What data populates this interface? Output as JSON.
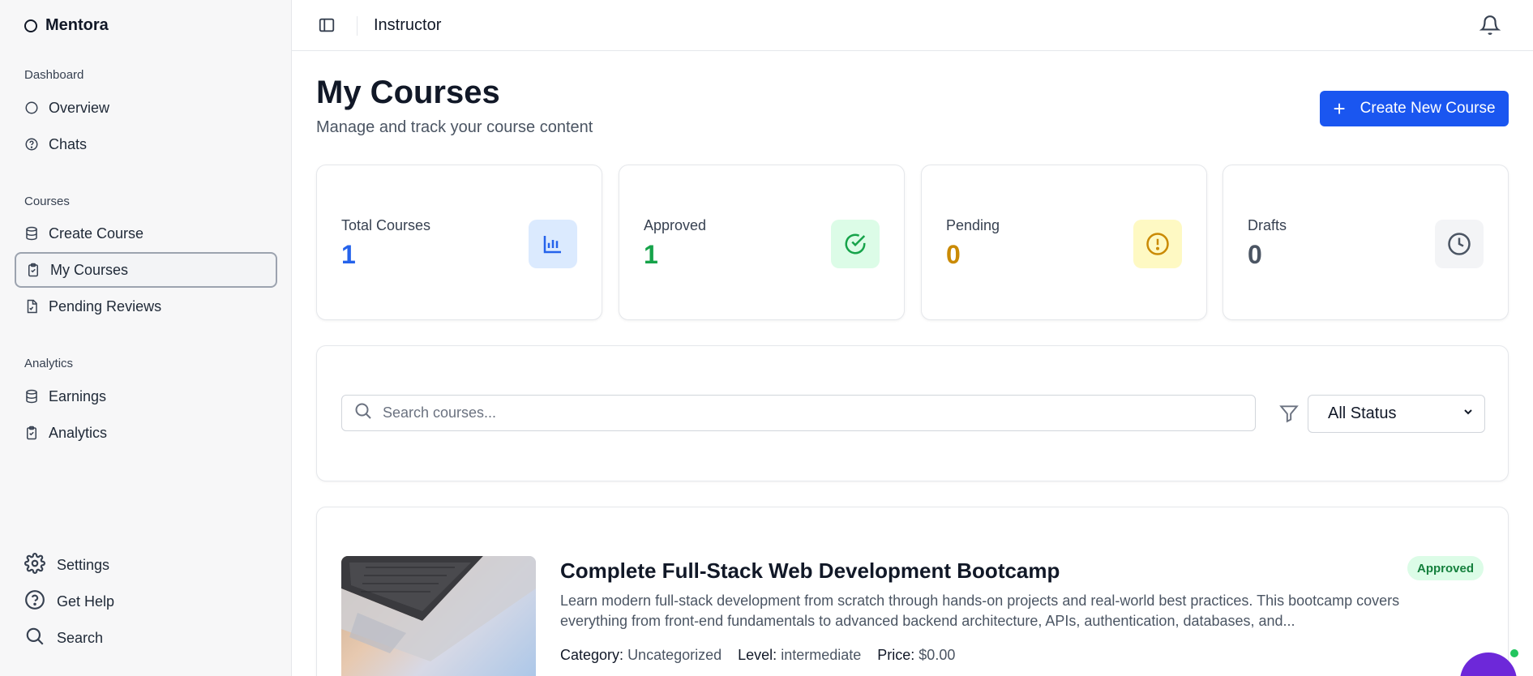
{
  "brand": {
    "name": "Mentora"
  },
  "sidebar": {
    "groups": [
      {
        "label": "Dashboard",
        "items": [
          {
            "label": "Overview",
            "icon": "circle-icon"
          },
          {
            "label": "Chats",
            "icon": "help-circle-icon"
          }
        ]
      },
      {
        "label": "Courses",
        "items": [
          {
            "label": "Create Course",
            "icon": "database-icon"
          },
          {
            "label": "My Courses",
            "icon": "clipboard-icon",
            "active": true
          },
          {
            "label": "Pending Reviews",
            "icon": "file-icon"
          }
        ]
      },
      {
        "label": "Analytics",
        "items": [
          {
            "label": "Earnings",
            "icon": "database-icon"
          },
          {
            "label": "Analytics",
            "icon": "clipboard-icon"
          }
        ]
      }
    ],
    "footer": [
      {
        "label": "Settings",
        "icon": "gear-icon"
      },
      {
        "label": "Get Help",
        "icon": "help-circle-icon"
      },
      {
        "label": "Search",
        "icon": "search-icon"
      }
    ]
  },
  "topbar": {
    "title": "Instructor"
  },
  "main": {
    "title": "My Courses",
    "subtitle": "Manage and track your course content",
    "create_button": "Create New Course"
  },
  "stats": [
    {
      "label": "Total Courses",
      "value": "1",
      "color": "#2563eb",
      "badge_bg": "#dbeafe",
      "icon": "bar-chart-icon"
    },
    {
      "label": "Approved",
      "value": "1",
      "color": "#16a34a",
      "badge_bg": "#dcfce7",
      "icon": "check-circle-icon"
    },
    {
      "label": "Pending",
      "value": "0",
      "color": "#ca8a04",
      "badge_bg": "#fef9c3",
      "icon": "alert-circle-icon"
    },
    {
      "label": "Drafts",
      "value": "0",
      "color": "#4b5563",
      "badge_bg": "#f3f4f6",
      "icon": "clock-icon"
    }
  ],
  "filters": {
    "search_placeholder": "Search courses...",
    "status_selected": "All Status"
  },
  "courses": [
    {
      "title": "Complete Full-Stack Web Development Bootcamp",
      "description": "Learn modern full-stack development from scratch through hands-on projects and real-world best practices. This bootcamp covers everything from front-end fundamentals to advanced backend architecture, APIs, authentication, databases, and...",
      "category_label": "Category:",
      "category": "Uncategorized",
      "level_label": "Level:",
      "level": "intermediate",
      "price_label": "Price:",
      "price": "$0.00",
      "status": "Approved"
    }
  ]
}
